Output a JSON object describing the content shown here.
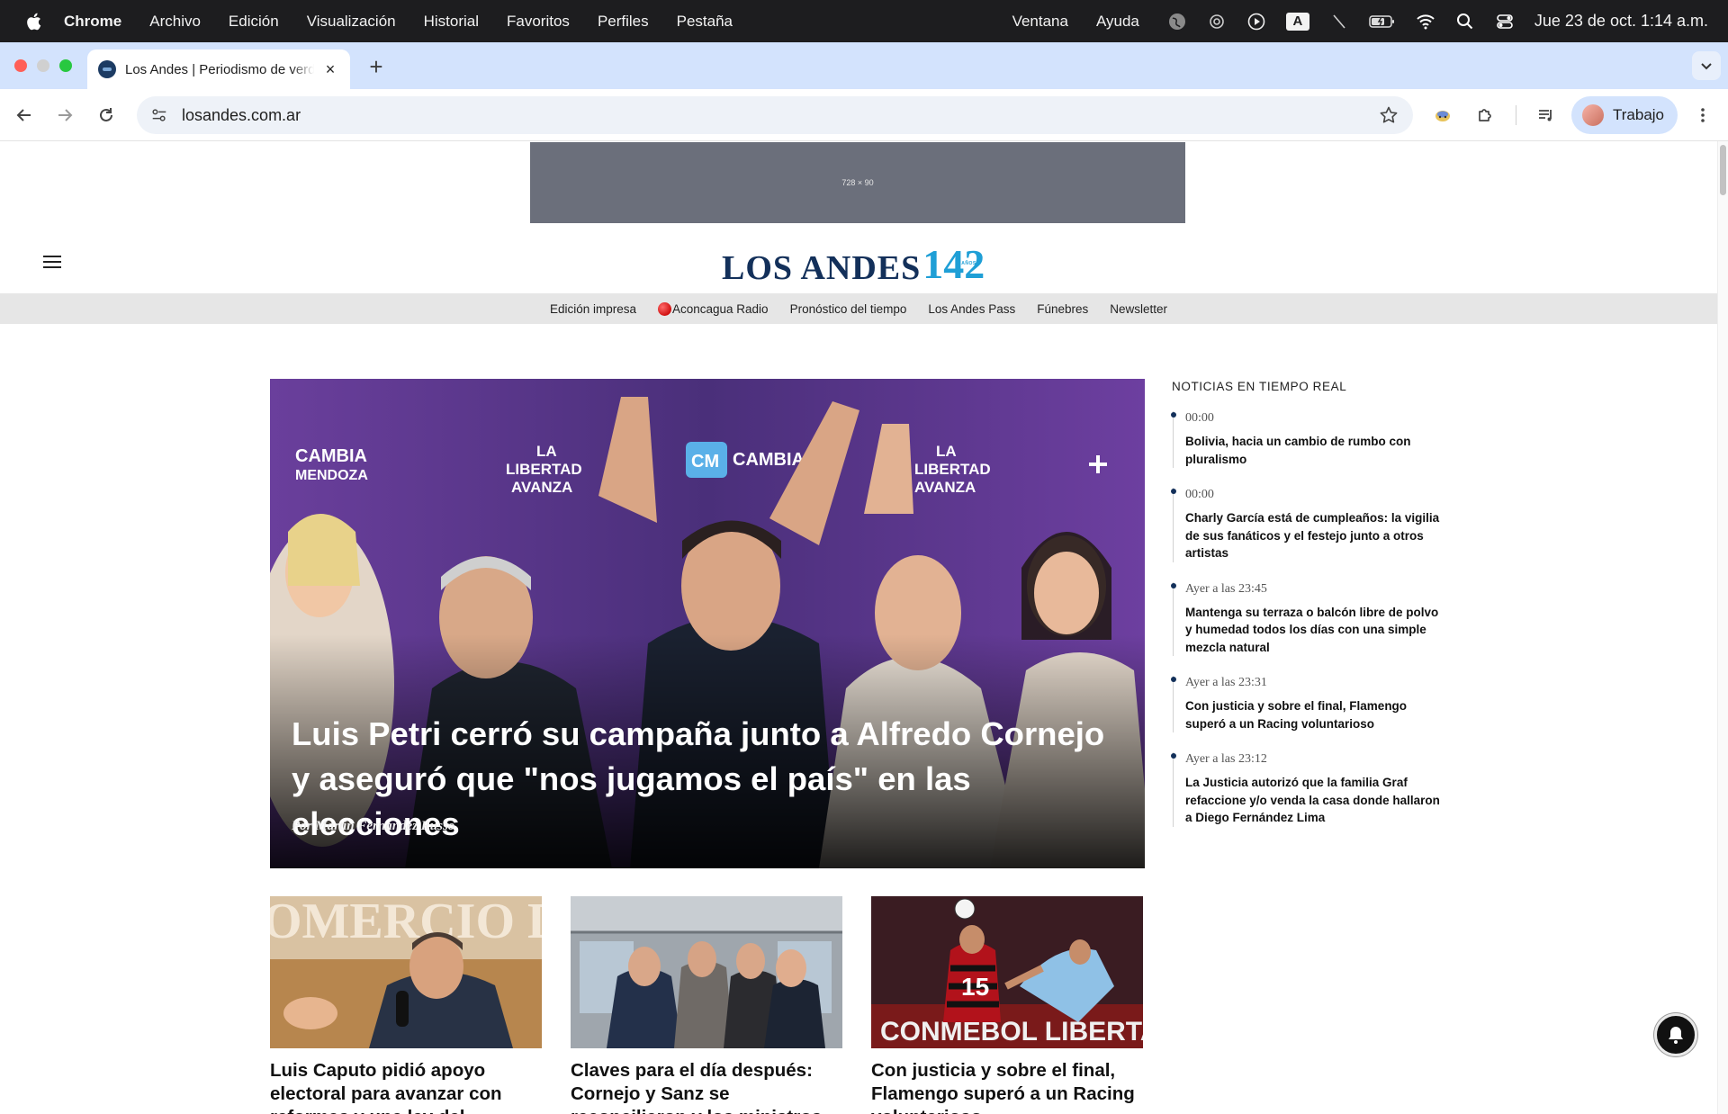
{
  "menubar": {
    "app": "Chrome",
    "items": [
      "Archivo",
      "Edición",
      "Visualización",
      "Historial",
      "Favoritos",
      "Perfiles",
      "Pestaña"
    ],
    "right_items": [
      "Ventana",
      "Ayuda"
    ],
    "keyboard_indicator": "A",
    "clock": "Jue 23 de oct. 1:14 a.m."
  },
  "browser": {
    "tab_title": "Los Andes | Periodismo de verdad",
    "tab_close": "×",
    "new_tab": "+",
    "url": "losandes.com.ar",
    "profile_label": "Trabajo"
  },
  "page": {
    "ad_label": "728 × 90",
    "logo": {
      "wordmark": "LOS ANDES",
      "number": "142",
      "sub": "AÑOS"
    },
    "nav": [
      "Edición impresa",
      "Aconcagua Radio",
      "Pronóstico del tiempo",
      "Los Andes Pass",
      "Fúnebres",
      "Newsletter"
    ],
    "hero": {
      "headline": "Luis Petri cerró su campaña junto a Alfredo Cornejo y aseguró que \"nos jugamos el país\" en las elecciones",
      "byline": "Por Martín Fernández Russo",
      "banner_texts": [
        "CAMBIA",
        "MENDOZA",
        "LA",
        "LIBERTAD",
        "AVANZA",
        "CM",
        "CAMBIA",
        "MENDOZA"
      ]
    },
    "realtime": {
      "title": "NOTICIAS EN TIEMPO REAL",
      "items": [
        {
          "time": "00:00",
          "text": "Bolivia, hacia un cambio de rumbo con pluralismo"
        },
        {
          "time": "00:00",
          "text": "Charly García está de cumpleaños: la vigilia de sus fanáticos y el festejo junto a otros artistas"
        },
        {
          "time": "Ayer a las 23:45",
          "text": "Mantenga su terraza o balcón libre de polvo y humedad todos los días con una simple mezcla natural"
        },
        {
          "time": "Ayer a las 23:31",
          "text": "Con justicia y sobre el final, Flamengo superó a un Racing voluntarioso"
        },
        {
          "time": "Ayer a las 23:12",
          "text": "La Justicia autorizó que la familia Graf refaccione y/o venda la casa donde hallaron a Diego Fernández Lima"
        }
      ]
    },
    "cards": [
      {
        "title": "Luis Caputo pidió apoyo electoral para avanzar con reformas y una ley del Impuesto de...",
        "thumb_text": "OMERCIO DOBA"
      },
      {
        "title": "Claves para el día después: Cornejo y Sanz se reconciliaron y los ministros ya piden pista",
        "thumb_text": ""
      },
      {
        "title": "Con justicia y sobre el final, Flamengo superó a un Racing voluntarioso",
        "thumb_text": "CONMEBOL LIBERTA"
      }
    ]
  },
  "colors": {
    "menubar_bg": "#1d1d1f",
    "tabstrip_bg": "#d3e3fd",
    "logo_navy": "#13305a",
    "logo_blue": "#1f9fd6",
    "nav_bg": "#e6e6e6",
    "ad_bg": "#6b6f7b"
  },
  "icons": [
    "apple-icon",
    "globe-icon",
    "screen-mirror-icon",
    "play-icon",
    "pen-icon",
    "battery-icon",
    "wifi-icon",
    "search-icon",
    "control-center-icon",
    "back-icon",
    "forward-icon",
    "reload-icon",
    "site-settings-icon",
    "star-icon",
    "extension-icon",
    "puzzle-icon",
    "media-queue-icon",
    "more-icon",
    "hamburger-icon",
    "bell-icon"
  ]
}
